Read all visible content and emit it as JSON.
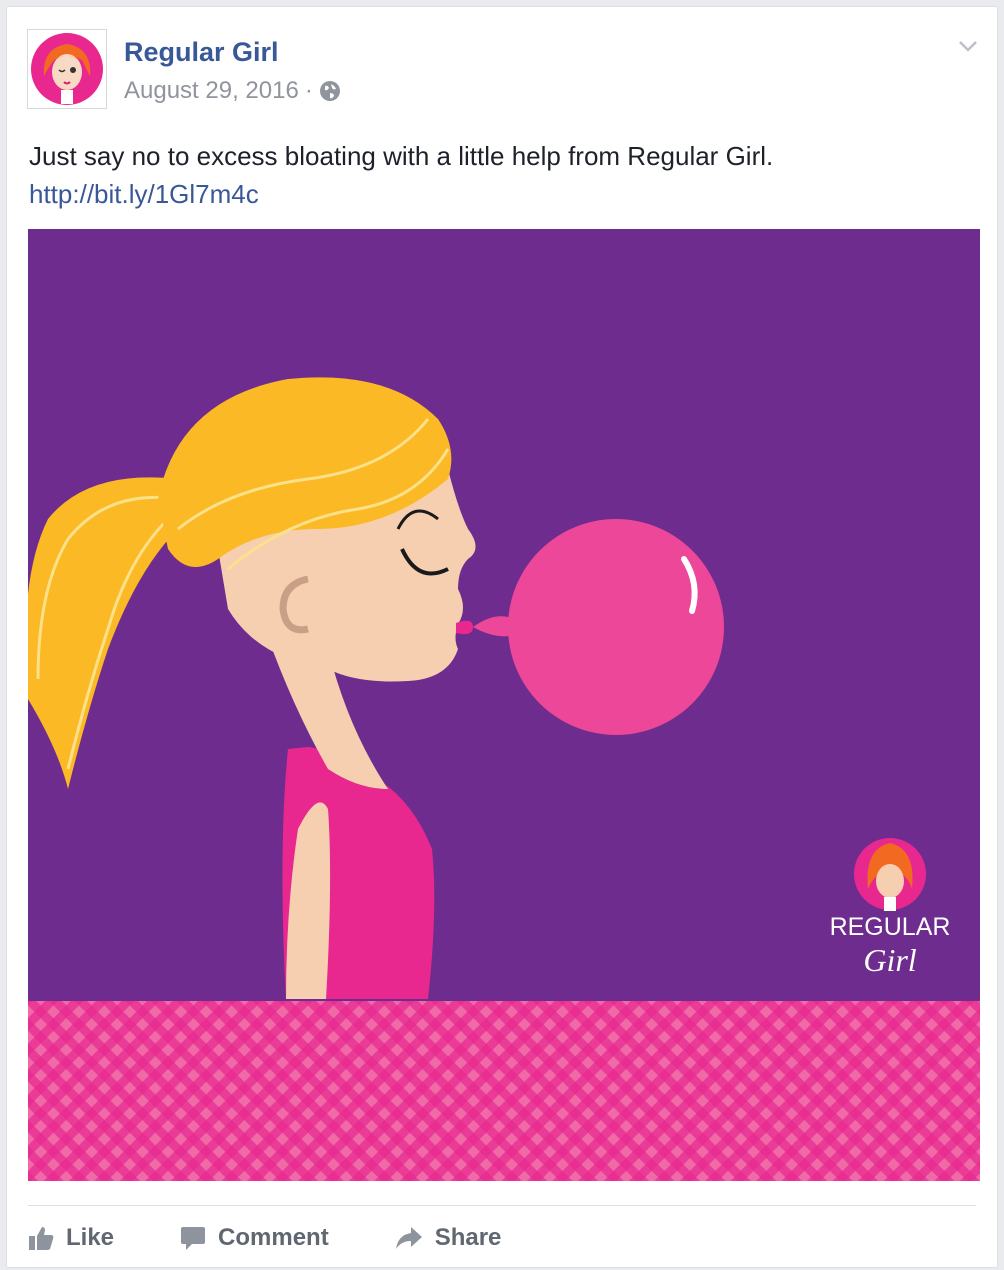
{
  "post": {
    "page_name": "Regular Girl",
    "date": "August 29, 2016",
    "separator": "·",
    "caption": "Just say no to excess bloating with a little help from Regular Girl.",
    "link": "http://bit.ly/1Gl7m4c",
    "image": {
      "logo_text_top": "REGULAR",
      "logo_text_bottom": "Girl",
      "background_color": "#6e2d8e",
      "pattern_color": "#e8288f"
    }
  },
  "actions": {
    "like": "Like",
    "comment": "Comment",
    "share": "Share"
  },
  "icons": {
    "privacy": "globe-icon",
    "menu": "chevron-down-icon",
    "like": "thumbs-up-icon",
    "comment": "comment-icon",
    "share": "share-arrow-icon"
  }
}
